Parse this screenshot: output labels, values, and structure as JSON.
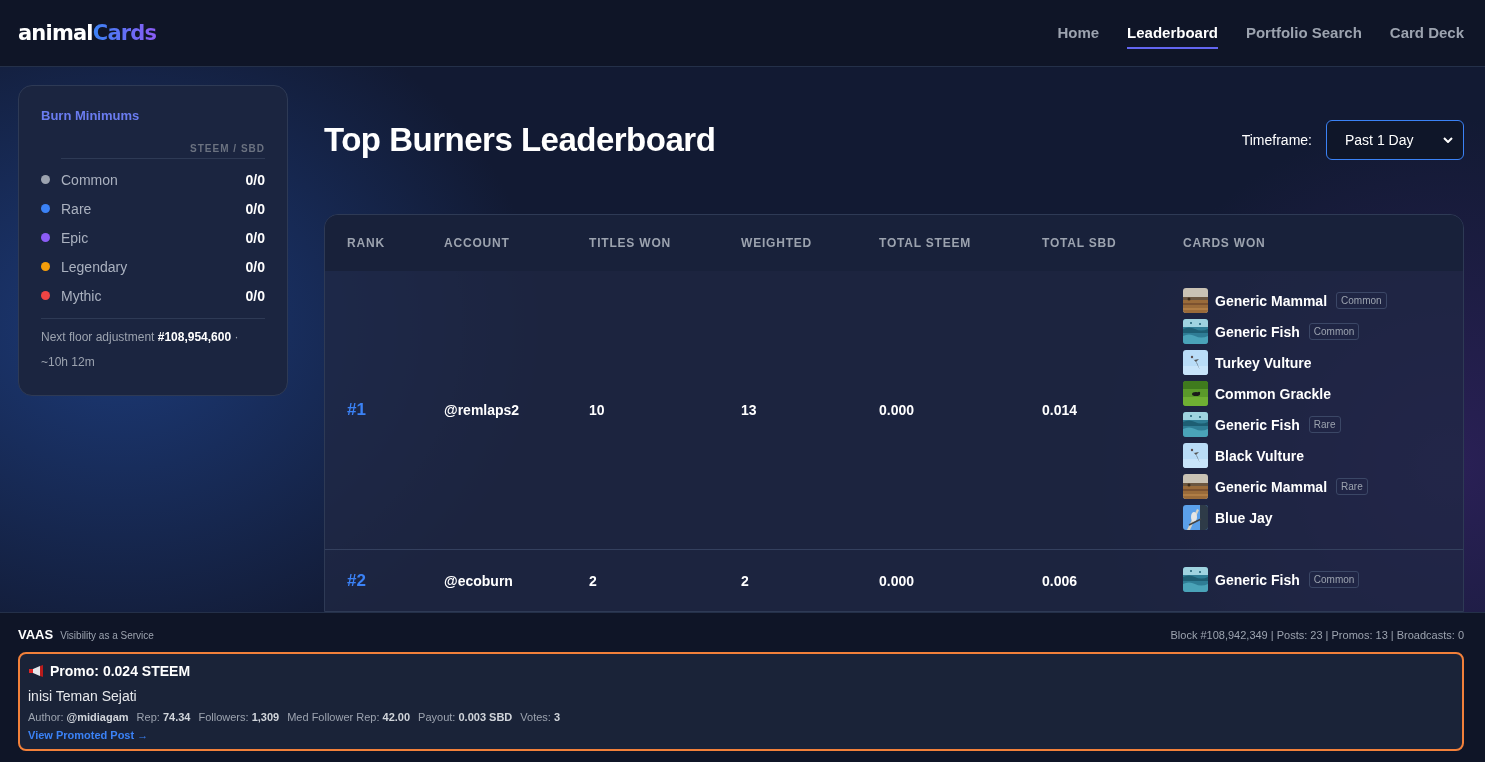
{
  "brand": {
    "first": "animal",
    "second": "Cards"
  },
  "nav": [
    {
      "label": "Home",
      "selected": false
    },
    {
      "label": "Leaderboard",
      "selected": true
    },
    {
      "label": "Portfolio Search",
      "selected": false
    },
    {
      "label": "Card Deck",
      "selected": false
    }
  ],
  "sidebar": {
    "title": "Burn Minimums",
    "column_header": "STEEM / SBD",
    "rarities": [
      {
        "name": "Common",
        "color": "#9ca3af",
        "value": "0/0"
      },
      {
        "name": "Rare",
        "color": "#3b82f6",
        "value": "0/0"
      },
      {
        "name": "Epic",
        "color": "#8b5cf6",
        "value": "0/0"
      },
      {
        "name": "Legendary",
        "color": "#f59e0b",
        "value": "0/0"
      },
      {
        "name": "Mythic",
        "color": "#ef4444",
        "value": "0/0"
      }
    ],
    "footnote": "Next floor adjustment **#108,954,600** · ~10h 12m"
  },
  "page_title": "Top Burners Leaderboard",
  "timeframe": {
    "label": "Timeframe:",
    "value": "Past 1 Day"
  },
  "table": {
    "columns": [
      "RANK",
      "ACCOUNT",
      "TITLES WON",
      "WEIGHTED",
      "TOTAL STEEM",
      "TOTAL SBD",
      "CARDS WON"
    ],
    "rows": [
      {
        "rank": "#1",
        "account": "@remlaps2",
        "titles_won": "10",
        "weighted": "13",
        "total_steem": "0.000",
        "total_sbd": "0.014",
        "cards": [
          {
            "name": "Generic Mammal",
            "rarity": "Common"
          },
          {
            "name": "Generic Fish",
            "rarity": "Common"
          },
          {
            "name": "Turkey Vulture"
          },
          {
            "name": "Common Grackle"
          },
          {
            "name": "Generic Fish",
            "rarity": "Rare"
          },
          {
            "name": "Black Vulture"
          },
          {
            "name": "Generic Mammal",
            "rarity": "Rare"
          },
          {
            "name": "Blue Jay"
          }
        ]
      },
      {
        "rank": "#2",
        "account": "@ecoburn",
        "titles_won": "2",
        "weighted": "2",
        "total_steem": "0.000",
        "total_sbd": "0.006",
        "cards": [
          {
            "name": "Generic Fish",
            "rarity": "Common"
          }
        ]
      }
    ]
  },
  "footer": {
    "name": "VAAS",
    "tagline": "Visibility as a Service",
    "status": "Block #108,942,349 | Posts: 23 | Promos: 13 | Broadcasts: 0",
    "promo": {
      "title": "Promo: 0.024 STEEM",
      "post_title": "inisi Teman Sejati",
      "meta": [
        {
          "label": "Author:",
          "value": "@midiagam"
        },
        {
          "label": "Rep:",
          "value": "74.34"
        },
        {
          "label": "Followers:",
          "value": "1,309"
        },
        {
          "label": "Med Follower Rep:",
          "value": "42.00"
        },
        {
          "label": "Payout:",
          "value": "0.003 SBD"
        },
        {
          "label": "Votes:",
          "value": "3"
        }
      ],
      "link": "View Promoted Post →"
    }
  }
}
